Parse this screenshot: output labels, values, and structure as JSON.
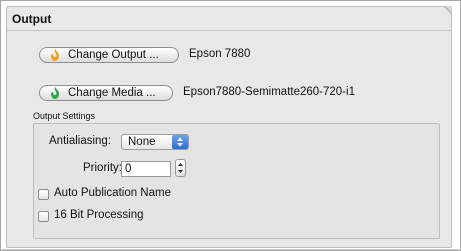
{
  "panel": {
    "title": "Output"
  },
  "output": {
    "change_output_label": "Change Output ...",
    "output_value": "Epson 7880",
    "change_media_label": "Change Media ...",
    "media_value": "Epson7880-Semimatte260-720-i1",
    "output_icon_color": "#f39c1f",
    "media_icon_color": "#2fa64a"
  },
  "output_settings": {
    "section_label": "Output Settings",
    "antialiasing_label": "Antialiasing:",
    "antialiasing_value": "None",
    "priority_label": "Priority:",
    "priority_value": "0",
    "auto_publication_label": "Auto Publication Name",
    "auto_publication_checked": false,
    "bit16_label": "16 Bit Processing",
    "bit16_checked": false
  }
}
